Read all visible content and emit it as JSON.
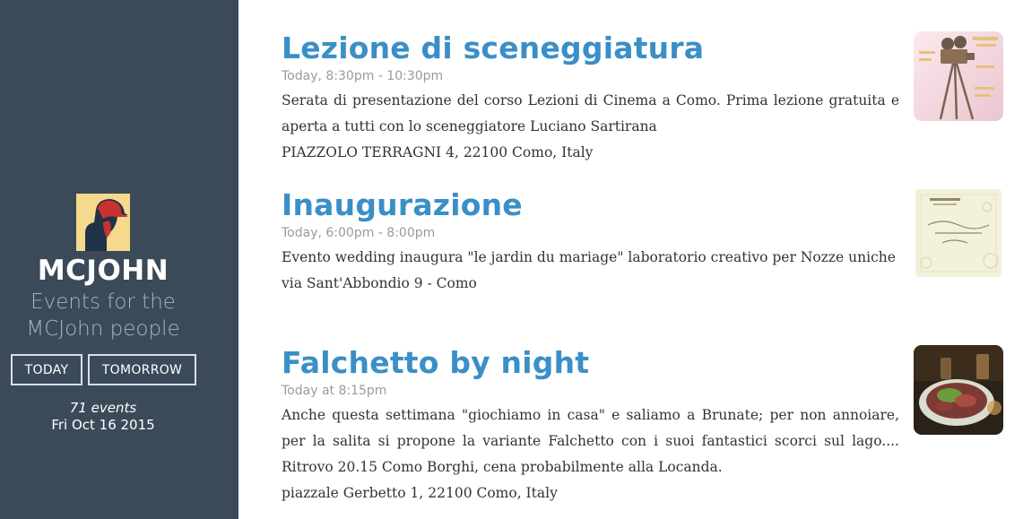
{
  "sidebar": {
    "brand": "MCJOHN",
    "tagline": "Events for the MCJohn people",
    "today_label": "TODAY",
    "tomorrow_label": "TOMORROW",
    "event_count": "71 events",
    "date": "Fri Oct 16 2015",
    "avatar_icon": "person-with-cap-avatar"
  },
  "events": [
    {
      "title": "Lezione di sceneggiatura",
      "time": "Today, 8:30pm - 10:30pm",
      "description": "Serata di presentazione del corso Lezioni di Cinema a Como. Prima lezione gratuita e aperta a tutti con lo sceneggiatore Luciano Sartirana",
      "address": "PIAZZOLO TERRAGNI 4, 22100 Como, Italy",
      "thumbnail": "film-camera-poster-image"
    },
    {
      "title": "Inaugurazione",
      "time": "Today, 6:00pm - 8:00pm",
      "description": "Evento wedding inaugura \"le jardin du mariage\" laboratorio creativo per Nozze uniche",
      "address": "via Sant'Abbondio 9 - Como",
      "thumbnail": "wedding-invitation-card-image"
    },
    {
      "title": "Falchetto by night",
      "time": "Today at 8:15pm",
      "description": "Anche questa settimana \"giochiamo in casa\" e saliamo a Brunate; per non annoiare, per la salita si propone la variante Falchetto con i suoi fantastici scorci sul lago.... Ritrovo 20.15 Como Borghi, cena probabilmente alla Locanda.",
      "address": "piazzale Gerbetto 1, 22100 Como, Italy",
      "thumbnail": "dinner-plate-photo-image"
    }
  ],
  "colors": {
    "sidebar_bg": "#3b4a58",
    "title_blue": "#3a8fc7",
    "muted_text": "#9a9a9a"
  }
}
